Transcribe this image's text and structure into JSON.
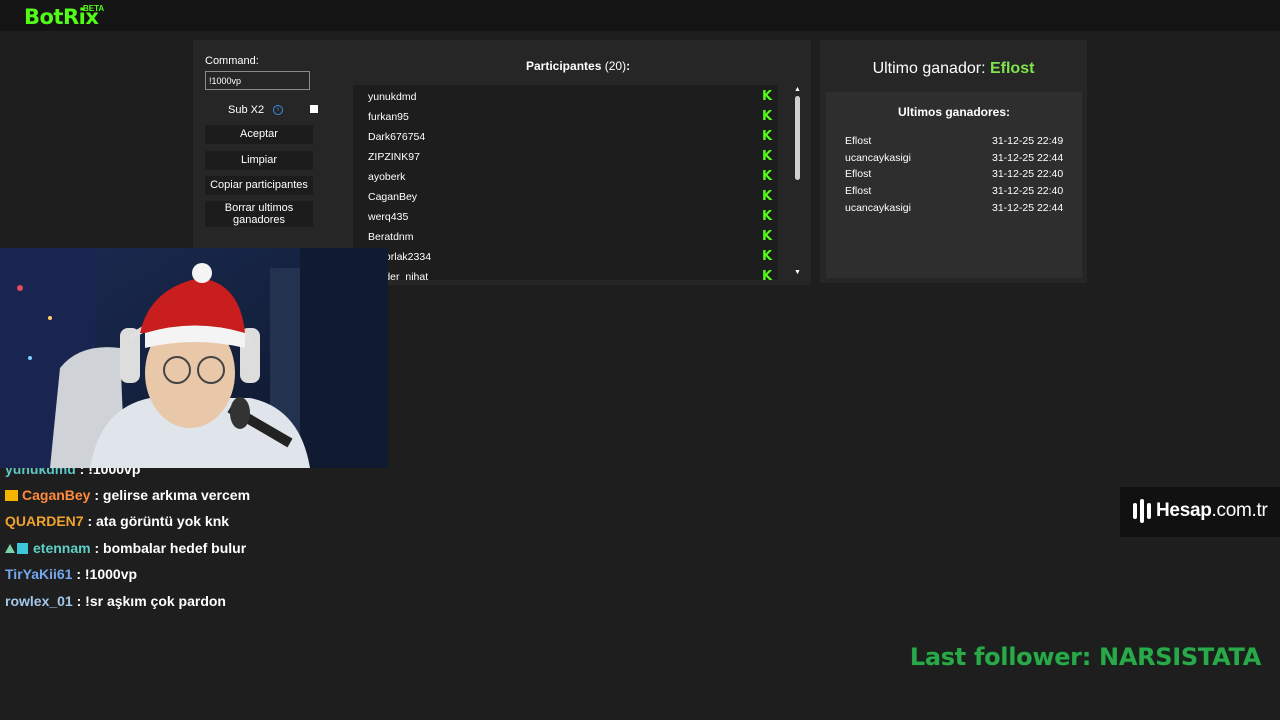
{
  "app": {
    "logo": "BotRix",
    "logo_badge": "BETA"
  },
  "giveaway_panel": {
    "command_label": "Command:",
    "command_value": "!1000vp",
    "subx2_label": "Sub X2",
    "buttons": {
      "accept": "Aceptar",
      "clear": "Limpiar",
      "copy_participants": "Copiar participantes",
      "clear_last_winners_line1": "Borrar ultimos",
      "clear_last_winners_line2": "ganadores"
    },
    "participants_title": "Participantes",
    "participants_count": "(20)",
    "participants_colon": ":",
    "participants": [
      "yunukdmd",
      "furkan95",
      "Dark676754",
      "ZIPZINK97",
      "ayoberk",
      "CaganBey",
      "werq435",
      "Beratdnm",
      "…rtorlak2334",
      "…oder_nihat"
    ]
  },
  "winners_panel": {
    "last_winner_label": "Ultimo ganador:",
    "last_winner": "Eflost",
    "list_title": "Ultimos ganadores:",
    "winners": [
      {
        "name": "Eflost",
        "date": "31-12-25 22:49"
      },
      {
        "name": "ucancaykasigi",
        "date": "31-12-25 22:44"
      },
      {
        "name": "Eflost",
        "date": "31-12-25 22:40"
      },
      {
        "name": "Eflost",
        "date": "31-12-25 22:40"
      },
      {
        "name": "ucancaykasigi",
        "date": "31-12-25 22:44"
      }
    ]
  },
  "chat": [
    {
      "user": "yunukdmd",
      "msg": ": !1000vp"
    },
    {
      "user": "CaganBey",
      "msg": ": gelirse arkıma vercem"
    },
    {
      "user": "QUARDEN7",
      "msg": ": ata görüntü yok knk"
    },
    {
      "user": "etennam",
      "msg": ": bombalar hedef bulur"
    },
    {
      "user": "TirYaKii61",
      "msg": ": !1000vp"
    },
    {
      "user": "rowlex_01",
      "msg": ": !sr aşkım çok pardon"
    }
  ],
  "sponsor": {
    "brand_bold": "Hesap",
    "brand_rest": ".com.tr"
  },
  "last_follower": "Last follower: NARSISTATA",
  "colors": {
    "kick_green": "#53fc18",
    "winner_green": "#7ee44a",
    "follower_green": "#2aa84a"
  }
}
